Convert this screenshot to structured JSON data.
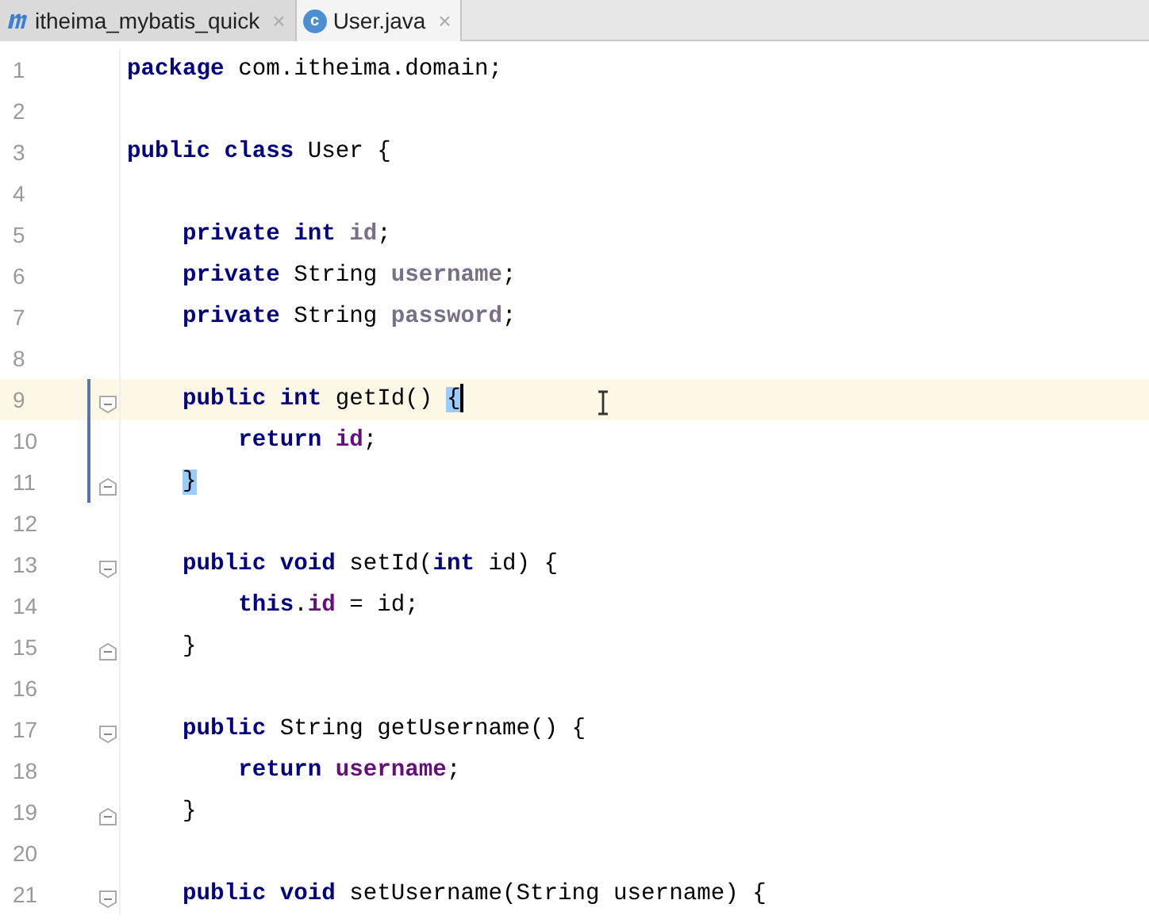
{
  "tabs": [
    {
      "label": "itheima_mybatis_quick",
      "kind": "module",
      "close": "×",
      "selected": false
    },
    {
      "label": "User.java",
      "kind": "class",
      "icon_letter": "c",
      "close": "×",
      "selected": true
    }
  ],
  "lines": [
    {
      "number": "1",
      "tokens": [
        {
          "text": "package",
          "kind": "keyword"
        },
        {
          "text": " com.itheima.domain;",
          "kind": "plain"
        }
      ]
    },
    {
      "number": "2"
    },
    {
      "number": "3",
      "tokens": [
        {
          "text": "public class",
          "kind": "keyword"
        },
        {
          "text": " User {",
          "kind": "plain"
        }
      ]
    },
    {
      "number": "4"
    },
    {
      "number": "5",
      "tokens": [
        {
          "text": "    private int",
          "kind": "keyword"
        },
        {
          "text": " id",
          "kind": "field-decl"
        },
        {
          "text": ";",
          "kind": "plain"
        }
      ]
    },
    {
      "number": "6",
      "tokens": [
        {
          "text": "    private",
          "kind": "keyword"
        },
        {
          "text": " String ",
          "kind": "plain"
        },
        {
          "text": "username",
          "kind": "field-decl"
        },
        {
          "text": ";",
          "kind": "plain"
        }
      ]
    },
    {
      "number": "7",
      "tokens": [
        {
          "text": "    private",
          "kind": "keyword"
        },
        {
          "text": " String ",
          "kind": "plain"
        },
        {
          "text": "password",
          "kind": "field-decl"
        },
        {
          "text": ";",
          "kind": "plain"
        }
      ]
    },
    {
      "number": "8"
    },
    {
      "number": "9",
      "current": true,
      "changed": true,
      "fold_start": true,
      "tokens": [
        {
          "text": "    public int",
          "kind": "keyword"
        },
        {
          "text": " getId() ",
          "kind": "plain"
        },
        {
          "text": "{",
          "kind": "brace-match",
          "caret": true
        }
      ]
    },
    {
      "number": "10",
      "changed": true,
      "tokens": [
        {
          "text": "        return",
          "kind": "keyword"
        },
        {
          "text": " id",
          "kind": "field"
        },
        {
          "text": ";",
          "kind": "plain"
        }
      ]
    },
    {
      "number": "11",
      "changed": true,
      "fold_end": true,
      "tokens": [
        {
          "text": "    }",
          "kind": "brace-match"
        }
      ]
    },
    {
      "number": "12"
    },
    {
      "number": "13",
      "fold_start": true,
      "tokens": [
        {
          "text": "    public void",
          "kind": "keyword"
        },
        {
          "text": " setId(",
          "kind": "plain"
        },
        {
          "text": "int",
          "kind": "keyword"
        },
        {
          "text": " id) {",
          "kind": "plain"
        }
      ]
    },
    {
      "number": "14",
      "tokens": [
        {
          "text": "        this",
          "kind": "keyword"
        },
        {
          "text": ".",
          "kind": "plain"
        },
        {
          "text": "id",
          "kind": "field"
        },
        {
          "text": " = id;",
          "kind": "plain"
        }
      ]
    },
    {
      "number": "15",
      "fold_end": true,
      "tokens": [
        {
          "text": "    }",
          "kind": "plain"
        }
      ]
    },
    {
      "number": "16"
    },
    {
      "number": "17",
      "fold_start": true,
      "tokens": [
        {
          "text": "    public",
          "kind": "keyword"
        },
        {
          "text": " String getUsername() {",
          "kind": "plain"
        }
      ]
    },
    {
      "number": "18",
      "tokens": [
        {
          "text": "        return",
          "kind": "keyword"
        },
        {
          "text": " username",
          "kind": "field"
        },
        {
          "text": ";",
          "kind": "plain"
        }
      ]
    },
    {
      "number": "19",
      "fold_end": true,
      "tokens": [
        {
          "text": "    }",
          "kind": "plain"
        }
      ]
    },
    {
      "number": "20"
    },
    {
      "number": "21",
      "fold_start": true,
      "tokens": [
        {
          "text": "    public void",
          "kind": "keyword"
        },
        {
          "text": " setUsername(String username) {",
          "kind": "plain"
        }
      ]
    }
  ]
}
